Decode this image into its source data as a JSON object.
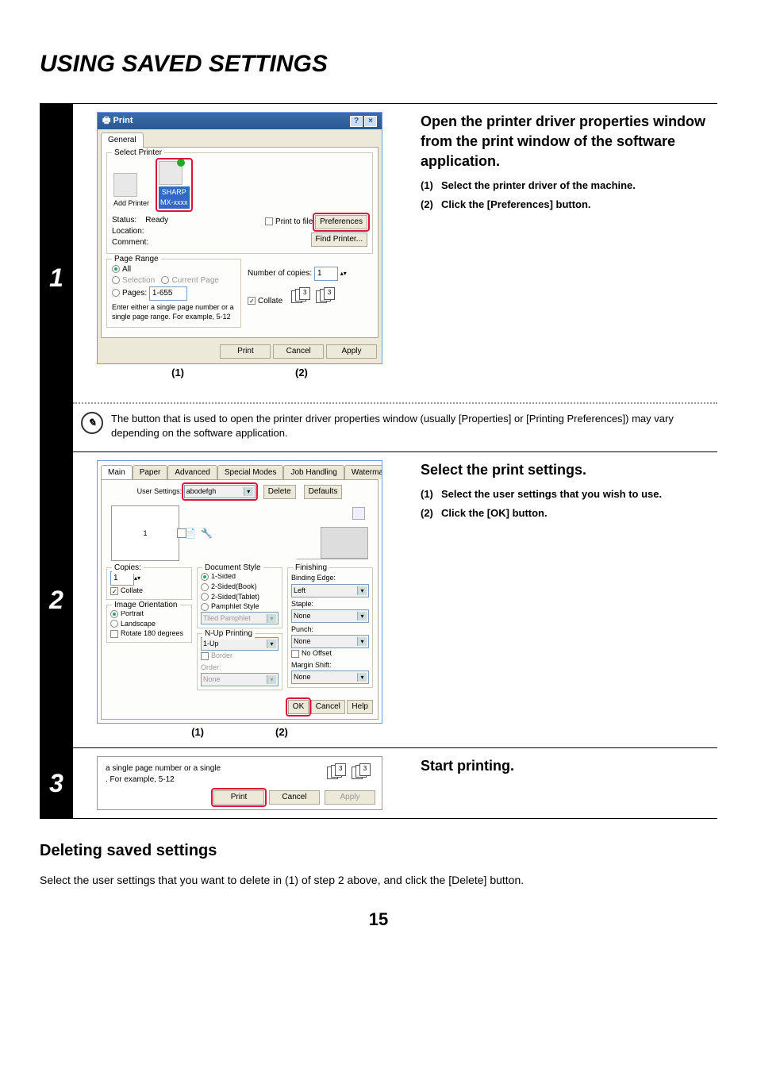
{
  "page_title": "USING SAVED SETTINGS",
  "page_number": "15",
  "step1": {
    "num": "1",
    "dialog": {
      "title_icon": "🖶",
      "title": "Print",
      "tab": "General",
      "select_printer_label": "Select Printer",
      "add_printer": "Add Printer",
      "selected_printer_line1": "SHARP",
      "selected_printer_line2": "MX-xxxx",
      "status_label": "Status:",
      "status_value": "Ready",
      "location_label": "Location:",
      "comment_label": "Comment:",
      "print_to_file": "Print to file",
      "preferences_btn": "Preferences",
      "find_printer_btn": "Find Printer...",
      "page_range_label": "Page Range",
      "all": "All",
      "selection": "Selection",
      "current_page": "Current Page",
      "pages": "Pages:",
      "pages_value": "1-655",
      "pages_hint": "Enter either a single page number or a single page range.  For example, 5-12",
      "copies_label": "Number of copies:",
      "copies_value": "1",
      "collate": "Collate",
      "print_btn": "Print",
      "cancel_btn": "Cancel",
      "apply_btn": "Apply"
    },
    "callouts": {
      "c1": "(1)",
      "c2": "(2)"
    },
    "instr_heading": "Open the printer driver properties window from the print window of the software application.",
    "instr_items": [
      "Select the printer driver of the machine.",
      "Click the [Preferences] button."
    ],
    "note": "The button that is used to open the printer driver properties window (usually [Properties] or [Printing Preferences]) may vary depending on the software application."
  },
  "step2": {
    "num": "2",
    "tabs": [
      "Main",
      "Paper",
      "Advanced",
      "Special Modes",
      "Job Handling",
      "Watermarks"
    ],
    "user_settings_label": "User Settings:",
    "user_settings_value": "abodefgh",
    "delete_btn": "Delete",
    "defaults_btn": "Defaults",
    "preview_page_num": "1",
    "left": {
      "copies_label": "Copies:",
      "copies_value": "1",
      "collate": "Collate",
      "orientation_label": "Image Orientation",
      "portrait": "Portrait",
      "landscape": "Landscape",
      "rotate": "Rotate 180 degrees"
    },
    "mid": {
      "doc_style": "Document Style",
      "one_sided": "1-Sided",
      "two_sided_book": "2-Sided(Book)",
      "two_sided_tablet": "2-Sided(Tablet)",
      "pamphlet": "Pamphlet Style",
      "tiled_pamphlet": "Tiled Pamphlet",
      "nup": "N-Up Printing",
      "nup_value": "1-Up",
      "border": "Border",
      "order_label": "Order:",
      "order_value": "None"
    },
    "right": {
      "finishing": "Finishing",
      "binding_edge": "Binding Edge:",
      "binding_value": "Left",
      "staple": "Staple:",
      "staple_value": "None",
      "punch": "Punch:",
      "punch_value": "None",
      "no_offset": "No Offset",
      "margin_shift": "Margin Shift:",
      "margin_value": "None"
    },
    "ok": "OK",
    "cancel": "Cancel",
    "help": "Help",
    "callouts": {
      "c1": "(1)",
      "c2": "(2)"
    },
    "instr_heading": "Select the print settings.",
    "instr_items": [
      "Select the user settings that you wish to use.",
      "Click the [OK] button."
    ]
  },
  "step3": {
    "num": "3",
    "hint_a": "a single page number or a single",
    "hint_b": ". For example, 5-12",
    "print": "Print",
    "cancel": "Cancel",
    "apply": "Apply",
    "instr_heading": "Start printing."
  },
  "deleting": {
    "heading": "Deleting saved settings",
    "body": "Select the user settings that you want to delete in (1) of step 2 above, and click the [Delete] button."
  }
}
